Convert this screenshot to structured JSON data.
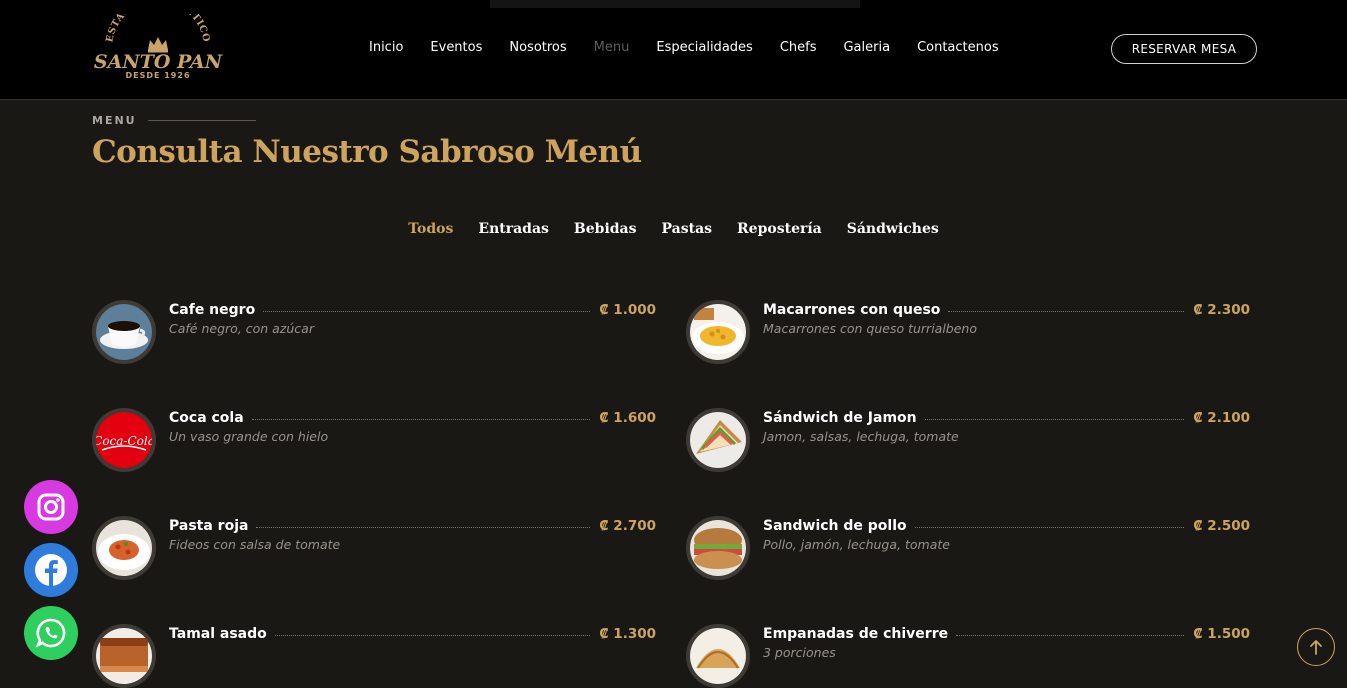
{
  "brand": {
    "arc_text": "ESTACIÓN ATLÁNTICO",
    "name": "SANTO PAN",
    "since": "DESDE 1926",
    "color": "#c9a56a"
  },
  "nav": {
    "items": [
      {
        "label": "Inicio",
        "active": false
      },
      {
        "label": "Eventos",
        "active": false
      },
      {
        "label": "Nosotros",
        "active": false
      },
      {
        "label": "Menu",
        "active": true
      },
      {
        "label": "Especialidades",
        "active": false
      },
      {
        "label": "Chefs",
        "active": false
      },
      {
        "label": "Galeria",
        "active": false
      },
      {
        "label": "Contactenos",
        "active": false
      }
    ],
    "reserve_label": "RESERVAR MESA"
  },
  "section": {
    "eyebrow": "MENU",
    "title": "Consulta Nuestro Sabroso Menú"
  },
  "filters": [
    {
      "label": "Todos",
      "active": true
    },
    {
      "label": "Entradas",
      "active": false
    },
    {
      "label": "Bebidas",
      "active": false
    },
    {
      "label": "Pastas",
      "active": false
    },
    {
      "label": "Repostería",
      "active": false
    },
    {
      "label": "Sándwiches",
      "active": false
    }
  ],
  "menu": {
    "left": [
      {
        "name": "Cafe negro",
        "price": "₡ 1.000",
        "desc": "Café negro, con azúcar",
        "icon": "coffee-cup-icon"
      },
      {
        "name": "Coca cola",
        "price": "₡ 1.600",
        "desc": "Un vaso grande con hielo",
        "icon": "coca-cola-icon"
      },
      {
        "name": "Pasta roja",
        "price": "₡ 2.700",
        "desc": "Fideos con salsa de tomate",
        "icon": "pasta-plate-icon"
      },
      {
        "name": "Tamal asado",
        "price": "₡ 1.300",
        "desc": "",
        "icon": "cake-slice-icon"
      }
    ],
    "right": [
      {
        "name": "Macarrones con queso",
        "price": "₡ 2.300",
        "desc": "Macarrones con queso turrialbeno",
        "icon": "mac-cheese-icon"
      },
      {
        "name": "Sándwich de Jamon",
        "price": "₡ 2.100",
        "desc": "Jamon, salsas, lechuga, tomate",
        "icon": "ham-sandwich-icon"
      },
      {
        "name": "Sandwich de pollo",
        "price": "₡ 2.500",
        "desc": "Pollo, jamón, lechuga, tomate",
        "icon": "chicken-sandwich-icon"
      },
      {
        "name": "Empanadas de chiverre",
        "price": "₡ 1.500",
        "desc": "3 porciones",
        "icon": "empanada-icon"
      }
    ]
  },
  "social": [
    {
      "icon": "instagram-icon",
      "color": "#d63ae0"
    },
    {
      "icon": "facebook-icon",
      "color": "#2f7cdc"
    },
    {
      "icon": "whatsapp-icon",
      "color": "#2ecf5e"
    }
  ],
  "accent": "#cda45e"
}
